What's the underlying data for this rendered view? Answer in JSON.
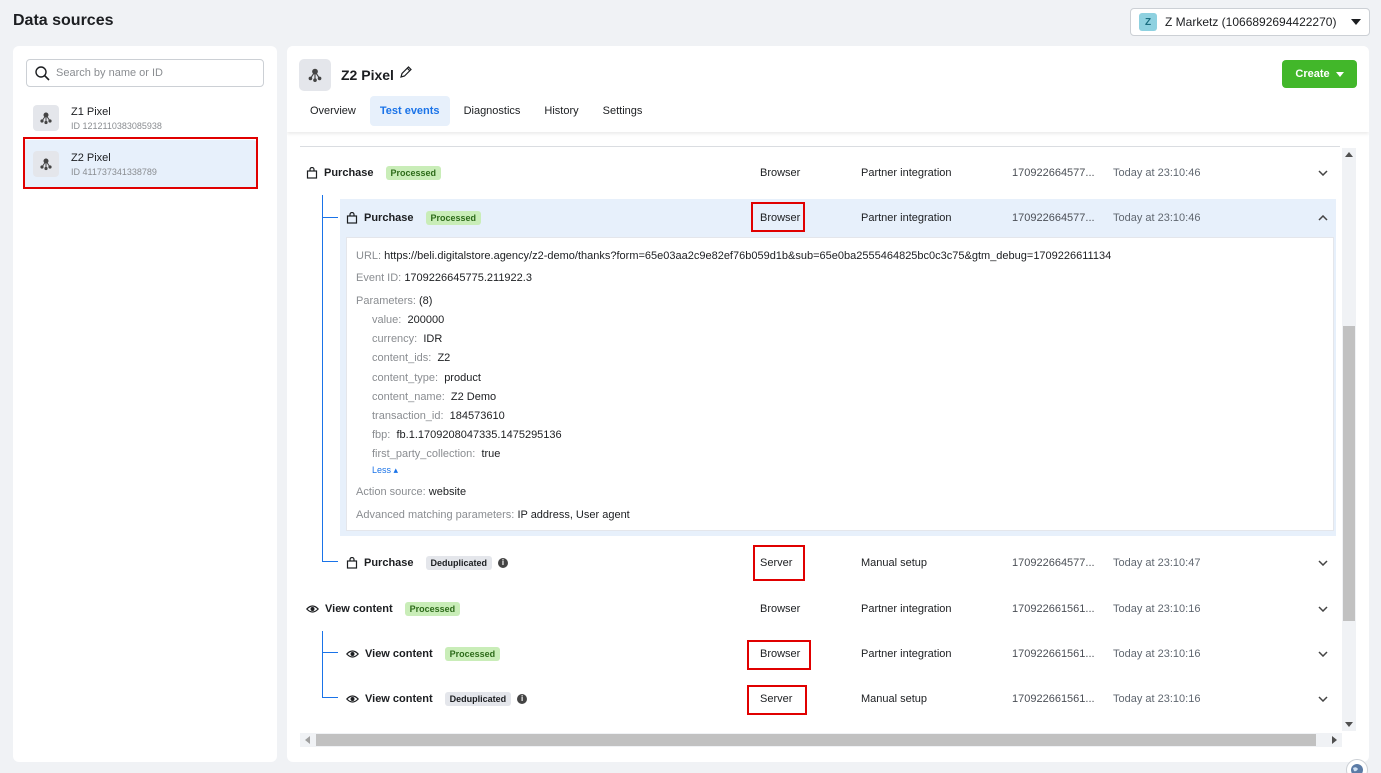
{
  "page": {
    "title": "Data sources"
  },
  "account": {
    "badge": "Z",
    "name": "Z Marketz (1066892694422270)"
  },
  "sidebar": {
    "search_placeholder": "Search by name or ID",
    "items": [
      {
        "name": "Z1 Pixel",
        "id": "ID 1212110383085938"
      },
      {
        "name": "Z2 Pixel",
        "id": "ID 411737341338789"
      }
    ]
  },
  "main": {
    "pixel_title": "Z2 Pixel",
    "create_label": "Create",
    "tabs": [
      "Overview",
      "Test events",
      "Diagnostics",
      "History",
      "Settings"
    ]
  },
  "events": [
    {
      "name": "Purchase",
      "badge": "Processed",
      "source": "Browser",
      "method": "Partner integration",
      "id": "170922664577...",
      "time": "Today at 23:10:46",
      "icon": "shopping-bag-icon"
    },
    {
      "name": "Purchase",
      "badge": "Processed",
      "source": "Browser",
      "method": "Partner integration",
      "id": "170922664577...",
      "time": "Today at 23:10:46",
      "icon": "shopping-bag-icon"
    },
    {
      "name": "Purchase",
      "badge": "Deduplicated",
      "source": "Server",
      "method": "Manual setup",
      "id": "170922664577...",
      "time": "Today at 23:10:47",
      "icon": "shopping-bag-icon"
    },
    {
      "name": "View content",
      "badge": "Processed",
      "source": "Browser",
      "method": "Partner integration",
      "id": "170922661561...",
      "time": "Today at 23:10:16",
      "icon": "eye-icon"
    },
    {
      "name": "View content",
      "badge": "Processed",
      "source": "Browser",
      "method": "Partner integration",
      "id": "170922661561...",
      "time": "Today at 23:10:16",
      "icon": "eye-icon"
    },
    {
      "name": "View content",
      "badge": "Deduplicated",
      "source": "Server",
      "method": "Manual setup",
      "id": "170922661561...",
      "time": "Today at 23:10:16",
      "icon": "eye-icon"
    }
  ],
  "detail": {
    "url_label": "URL:",
    "url": "https://beli.digitalstore.agency/z2-demo/thanks?form=65e03aa2c9e82ef76b059d1b&sub=65e0ba2555464825bc0c3c75&gtm_debug=1709226611134",
    "event_id_label": "Event ID:",
    "event_id": "1709226645775.211922.3",
    "params_label": "Parameters:",
    "params_count": "(8)",
    "params": [
      {
        "k": "value:",
        "v": "200000"
      },
      {
        "k": "currency:",
        "v": "IDR"
      },
      {
        "k": "content_ids:",
        "v": "Z2"
      },
      {
        "k": "content_type:",
        "v": "product"
      },
      {
        "k": "content_name:",
        "v": "Z2 Demo"
      },
      {
        "k": "transaction_id:",
        "v": "184573610"
      },
      {
        "k": "fbp:",
        "v": "fb.1.1709208047335.1475295136"
      },
      {
        "k": "first_party_collection:",
        "v": "true"
      }
    ],
    "less_label": "Less",
    "action_label": "Action source:",
    "action_value": "website",
    "amp_label": "Advanced matching parameters:",
    "amp_value": "IP address, User agent"
  },
  "colors": {
    "accent": "#1a73e8",
    "create": "#42b72a",
    "highlight": "#e00000"
  }
}
